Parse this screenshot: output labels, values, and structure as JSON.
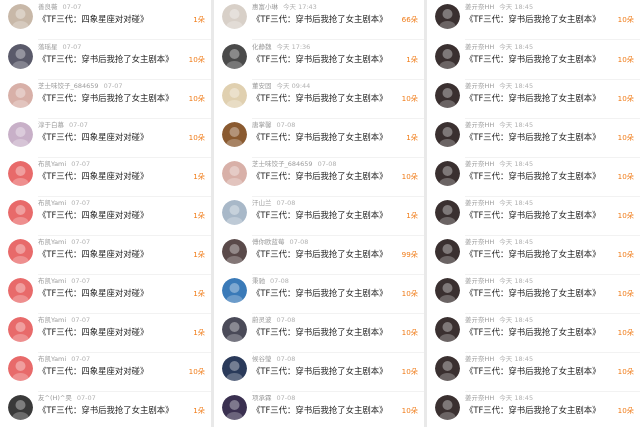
{
  "columns": [
    {
      "rows": [
        {
          "name": "善良薇",
          "time": "07-07",
          "text": "《TF三代：四象星座对对碰》",
          "count": "1朵",
          "avatar": "#c8b8a8"
        },
        {
          "name": "落瑶星",
          "time": "07-07",
          "text": "《TF三代：穿书后我抢了女主剧本》",
          "count": "10朵",
          "avatar": "#5a5a6a"
        },
        {
          "name": "芝士味饺子_684659",
          "time": "07-07",
          "text": "《TF三代：穿书后我抢了女主剧本》",
          "count": "10朵",
          "avatar": "#d8b0a8"
        },
        {
          "name": "淳于白慕",
          "time": "07-07",
          "text": "《TF三代：四象星座对对碰》",
          "count": "10朵",
          "avatar": "#c8b0c8"
        },
        {
          "name": "布凯Yami",
          "time": "07-07",
          "text": "《TF三代：四象星座对对碰》",
          "count": "1朵",
          "avatar": "#e86a6a"
        },
        {
          "name": "布凯Yami",
          "time": "07-07",
          "text": "《TF三代：四象星座对对碰》",
          "count": "1朵",
          "avatar": "#e86a6a"
        },
        {
          "name": "布凯Yami",
          "time": "07-07",
          "text": "《TF三代：四象星座对对碰》",
          "count": "1朵",
          "avatar": "#e86a6a"
        },
        {
          "name": "布凯Yami",
          "time": "07-07",
          "text": "《TF三代：四象星座对对碰》",
          "count": "1朵",
          "avatar": "#e86a6a"
        },
        {
          "name": "布凯Yami",
          "time": "07-07",
          "text": "《TF三代：四象星座对对碰》",
          "count": "1朵",
          "avatar": "#e86a6a"
        },
        {
          "name": "布凯Yami",
          "time": "07-07",
          "text": "《TF三代：四象星座对对碰》",
          "count": "10朵",
          "avatar": "#e86a6a"
        },
        {
          "name": "友^(H)^昊",
          "time": "07-07",
          "text": "《TF三代：穿书后我抢了女主剧本》",
          "count": "1朵",
          "avatar": "#3a3a3a"
        }
      ]
    },
    {
      "rows": [
        {
          "name": "惠富小琳",
          "time": "今天 17:43",
          "text": "《TF三代：穿书后我抢了女主剧本》",
          "count": "66朵",
          "avatar": "#d8d0c8"
        },
        {
          "name": "化静魏",
          "time": "今天 17:36",
          "text": "《TF三代：穿书后我抢了女主剧本》",
          "count": "1朵",
          "avatar": "#4a4a4a"
        },
        {
          "name": "董安固",
          "time": "今天 09:44",
          "text": "《TF三代：穿书后我抢了女主剧本》",
          "count": "10朵",
          "avatar": "#e0d0b0"
        },
        {
          "name": "唐掌馨",
          "time": "07-08",
          "text": "《TF三代：穿书后我抢了女主剧本》",
          "count": "1朵",
          "avatar": "#8a5a30"
        },
        {
          "name": "芝士味饺子_684659",
          "time": "07-08",
          "text": "《TF三代：穿书后我抢了女主剧本》",
          "count": "10朵",
          "avatar": "#d8b0a8"
        },
        {
          "name": "汗山兰",
          "time": "07-08",
          "text": "《TF三代：穿书后我抢了女主剧本》",
          "count": "1朵",
          "avatar": "#a8b8c8"
        },
        {
          "name": "傅你欧蓝莓",
          "time": "07-08",
          "text": "《TF三代：穿书后我抢了女主剧本》",
          "count": "99朵",
          "avatar": "#5a4a4a"
        },
        {
          "name": "秉驰",
          "time": "07-08",
          "text": "《TF三代：穿书后我抢了女主剧本》",
          "count": "10朵",
          "avatar": "#3a7ab8"
        },
        {
          "name": "蔚灵波",
          "time": "07-08",
          "text": "《TF三代：穿书后我抢了女主剧本》",
          "count": "10朵",
          "avatar": "#4a4a58"
        },
        {
          "name": "候谷瑩",
          "time": "07-08",
          "text": "《TF三代：穿书后我抢了女主剧本》",
          "count": "10朵",
          "avatar": "#2a3a5a"
        },
        {
          "name": "项承霖",
          "time": "07-08",
          "text": "《TF三代：穿书后我抢了女主剧本》",
          "count": "10朵",
          "avatar": "#3a3050"
        }
      ]
    },
    {
      "rows": [
        {
          "name": "姜亓奈HH",
          "time": "今天 18:45",
          "text": "《TF三代：穿书后我抢了女主剧本》",
          "count": "10朵",
          "avatar": "#3a3030"
        },
        {
          "name": "姜亓奈HH",
          "time": "今天 18:45",
          "text": "《TF三代：穿书后我抢了女主剧本》",
          "count": "10朵",
          "avatar": "#3a3030"
        },
        {
          "name": "姜亓奈HH",
          "time": "今天 18:45",
          "text": "《TF三代：穿书后我抢了女主剧本》",
          "count": "10朵",
          "avatar": "#3a3030"
        },
        {
          "name": "姜亓奈HH",
          "time": "今天 18:45",
          "text": "《TF三代：穿书后我抢了女主剧本》",
          "count": "10朵",
          "avatar": "#3a3030"
        },
        {
          "name": "姜亓奈HH",
          "time": "今天 18:45",
          "text": "《TF三代：穿书后我抢了女主剧本》",
          "count": "10朵",
          "avatar": "#3a3030"
        },
        {
          "name": "姜亓奈HH",
          "time": "今天 18:45",
          "text": "《TF三代：穿书后我抢了女主剧本》",
          "count": "10朵",
          "avatar": "#3a3030"
        },
        {
          "name": "姜亓奈HH",
          "time": "今天 18:45",
          "text": "《TF三代：穿书后我抢了女主剧本》",
          "count": "10朵",
          "avatar": "#3a3030"
        },
        {
          "name": "姜亓奈HH",
          "time": "今天 18:45",
          "text": "《TF三代：穿书后我抢了女主剧本》",
          "count": "10朵",
          "avatar": "#3a3030"
        },
        {
          "name": "姜亓奈HH",
          "time": "今天 18:45",
          "text": "《TF三代：穿书后我抢了女主剧本》",
          "count": "10朵",
          "avatar": "#3a3030"
        },
        {
          "name": "姜亓奈HH",
          "time": "今天 18:45",
          "text": "《TF三代：穿书后我抢了女主剧本》",
          "count": "10朵",
          "avatar": "#3a3030"
        },
        {
          "name": "姜亓奈HH",
          "time": "今天 18:45",
          "text": "《TF三代：穿书后我抢了女主剧本》",
          "count": "10朵",
          "avatar": "#3a3030"
        }
      ]
    }
  ],
  "colors": {
    "count": "#f07b17",
    "name": "#9a9a9a",
    "text": "#222222"
  }
}
